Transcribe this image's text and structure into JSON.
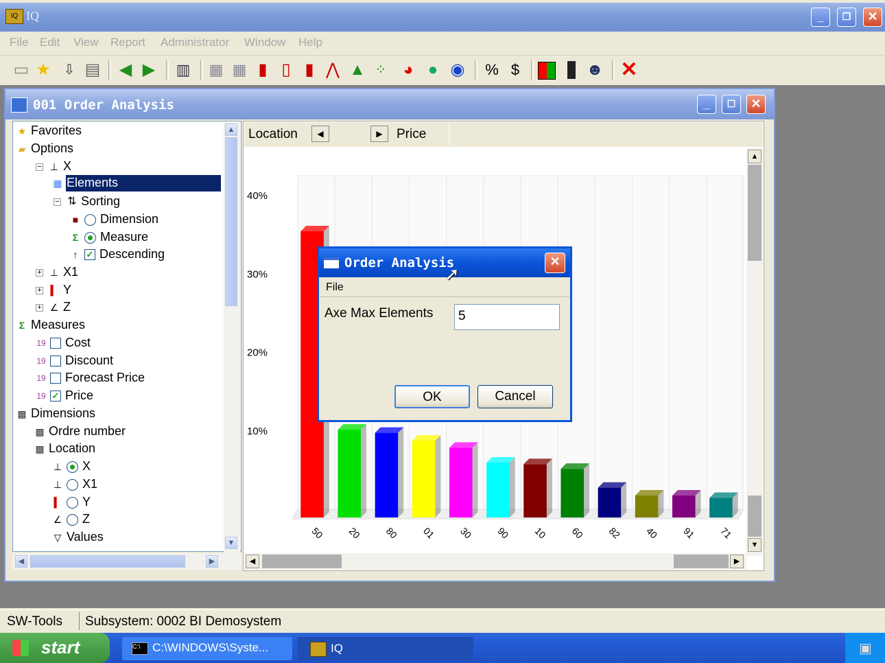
{
  "app": {
    "title": "IQ",
    "menu": [
      "File",
      "Edit",
      "View",
      "Report",
      "Administrator",
      "Window",
      "Help"
    ],
    "toolbar_icons": [
      "new-icon",
      "favorite-star-icon",
      "import-icon",
      "print-icon",
      "back-icon",
      "forward-icon",
      "layout-icon",
      "grid-icon",
      "grid-add-icon",
      "bar-chart-icon",
      "bar-chart-2-icon",
      "bar-chart-3-icon",
      "line-chart-icon",
      "area-chart-icon",
      "scatter-icon",
      "pie-chart-icon",
      "globe-icon",
      "info-icon"
    ],
    "toolbar_text": {
      "percent": "%",
      "currency": "$"
    }
  },
  "child": {
    "title": "001  Order Analysis"
  },
  "tree": {
    "favorites": "Favorites",
    "options": "Options",
    "x": "X",
    "elements": "Elements",
    "sorting": "Sorting",
    "dimension": "Dimension",
    "measure": "Measure",
    "descending": "Descending",
    "x1": "X1",
    "y": "Y",
    "z": "Z",
    "measures": "Measures",
    "cost": "Cost",
    "discount": "Discount",
    "forecast_price": "Forecast Price",
    "price": "Price",
    "dimensions": "Dimensions",
    "ordre_number": "Ordre number",
    "location": "Location",
    "loc_x": "X",
    "loc_x1": "X1",
    "loc_y": "Y",
    "loc_z": "Z",
    "values": "Values"
  },
  "pane": {
    "dimension_label": "Location",
    "measure_label": "Price"
  },
  "chart_data": {
    "type": "bar",
    "categories": [
      "50",
      "20",
      "80",
      "01",
      "30",
      "90",
      "10",
      "60",
      "82",
      "40",
      "91",
      "71"
    ],
    "values": [
      36.5,
      11.2,
      10.8,
      9.8,
      8.9,
      7.0,
      6.8,
      6.2,
      3.8,
      2.8,
      2.8,
      2.5
    ],
    "yticks": [
      "10%",
      "20%",
      "30%",
      "40%"
    ],
    "ylim": [
      0,
      45
    ],
    "colors": [
      "#ff0000",
      "#00e000",
      "#0000ff",
      "#ffff00",
      "#ff00ff",
      "#00ffff",
      "#800000",
      "#008000",
      "#000080",
      "#808000",
      "#800080",
      "#008080"
    ]
  },
  "dialog": {
    "title": "Order Analysis",
    "menu": "File",
    "field_label": "Axe Max Elements",
    "field_value": "5",
    "ok": "OK",
    "cancel": "Cancel"
  },
  "status": {
    "left": "SW-Tools",
    "right": "Subsystem: 0002 BI Demosystem"
  },
  "taskbar": {
    "start": "start",
    "task1": "C:\\WINDOWS\\Syste...",
    "task2": "IQ"
  }
}
